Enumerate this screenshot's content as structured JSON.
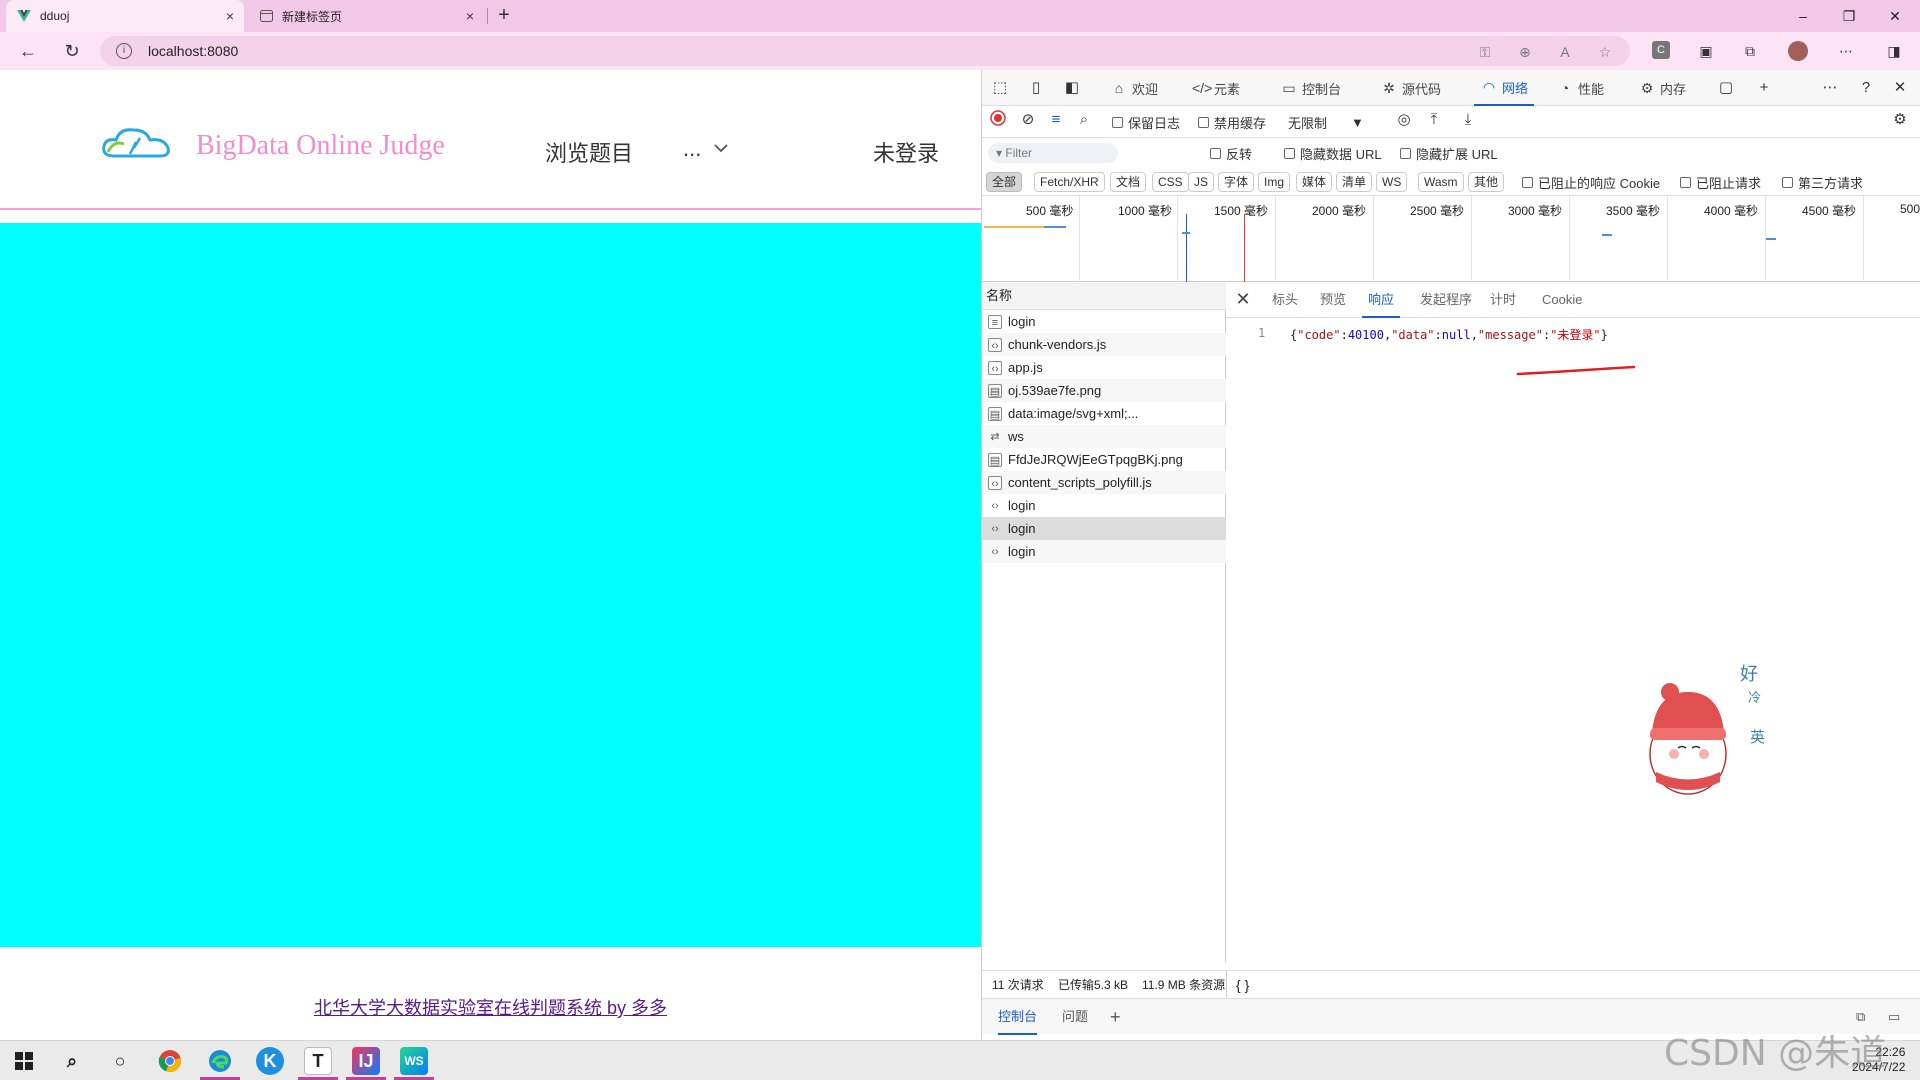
{
  "browser": {
    "tabs": [
      {
        "title": "dduoj",
        "icon": "vue-logo-icon",
        "active": true
      },
      {
        "title": "新建标签页",
        "icon": "new-tab-page-icon",
        "active": false
      }
    ],
    "close_glyph": "×",
    "new_tab_glyph": "+",
    "window_controls": {
      "minimize": "–",
      "restore": "❐",
      "close": "✕"
    },
    "url": "localhost:8080",
    "info_glyph": "i"
  },
  "site": {
    "brand": "BigData Online Judge",
    "nav": {
      "browse": "浏览题目",
      "more": "...",
      "login": "未登录"
    },
    "accent_color": "#f28cd0",
    "content_color": "#00ffff",
    "footer": "北华大学大数据实验室在线判题系统 by 多多"
  },
  "devtools": {
    "tabs": [
      {
        "label": "欢迎",
        "icon": "home-icon"
      },
      {
        "label": "元素",
        "icon": "code-icon"
      },
      {
        "label": "控制台",
        "icon": "console-icon"
      },
      {
        "label": "源代码",
        "icon": "bug-icon"
      },
      {
        "label": "网络",
        "icon": "wifi-icon",
        "selected": true
      },
      {
        "label": "性能",
        "icon": "performance-icon"
      },
      {
        "label": "内存",
        "icon": "memory-icon"
      }
    ],
    "toolbar": {
      "preserve_log": "保留日志",
      "disable_cache": "禁用缓存",
      "throttling": "无限制"
    },
    "filter": {
      "placeholder": "Filter",
      "invert": "反转",
      "hide_data_url": "隐藏数据 URL",
      "hide_ext_url": "隐藏扩展 URL"
    },
    "types": [
      "全部",
      "Fetch/XHR",
      "文档",
      "CSS",
      "JS",
      "字体",
      "Img",
      "媒体",
      "清单",
      "WS",
      "Wasm",
      "其他"
    ],
    "type_checks": {
      "blocked_cookies": "已阻止的响应 Cookie",
      "blocked_requests": "已阻止请求",
      "third_party": "第三方请求"
    },
    "timeline_labels": [
      "500 毫秒",
      "1000 毫秒",
      "1500 毫秒",
      "2000 毫秒",
      "2500 毫秒",
      "3000 毫秒",
      "3500 毫秒",
      "4000 毫秒",
      "4500 毫秒",
      "500"
    ],
    "requests_header": "名称",
    "requests": [
      {
        "name": "login",
        "icon": "document-icon"
      },
      {
        "name": "chunk-vendors.js",
        "icon": "script-icon"
      },
      {
        "name": "app.js",
        "icon": "script-icon"
      },
      {
        "name": "oj.539ae7fe.png",
        "icon": "image-file-icon"
      },
      {
        "name": "data:image/svg+xml;...",
        "icon": "image-file-icon"
      },
      {
        "name": "ws",
        "icon": "websocket-icon"
      },
      {
        "name": "FfdJeJRQWjEeGTpqgBKj.png",
        "icon": "image-file-icon"
      },
      {
        "name": "content_scripts_polyfill.js",
        "icon": "script-icon"
      },
      {
        "name": "login",
        "icon": "fetch-icon"
      },
      {
        "name": "login",
        "icon": "fetch-icon",
        "selected": true
      },
      {
        "name": "login",
        "icon": "fetch-icon"
      }
    ],
    "detail_tabs": [
      "标头",
      "预览",
      "响应",
      "发起程序",
      "计时",
      "Cookie"
    ],
    "response": {
      "line_number": "1",
      "open": "{",
      "code_key": "\"code\"",
      "code_val": "40100",
      "data_key": "\"data\"",
      "data_val": "null",
      "message_key": "\"message\"",
      "message_val": "\"未登录\"",
      "close": "}",
      "colon": ":",
      "comma": ","
    },
    "status": {
      "requests": "11 次请求",
      "transferred": "已传输5.3 kB",
      "resources": "11.9 MB 条资源",
      "braces": "{ }"
    },
    "drawer_tabs": [
      "控制台",
      "问题"
    ]
  },
  "sticker": {
    "text1": "好",
    "text2": "冷",
    "text3": "英"
  },
  "taskbar": {
    "apps": [
      "windows-start-icon",
      "search-icon",
      "task-view-icon",
      "chrome-icon",
      "edge-icon",
      "k-app-icon",
      "typora-icon",
      "intellij-icon",
      "webstorm-icon"
    ],
    "clock_time": "22:26",
    "clock_date": "2024/7/22"
  },
  "watermark": "CSDN @朱道阳"
}
